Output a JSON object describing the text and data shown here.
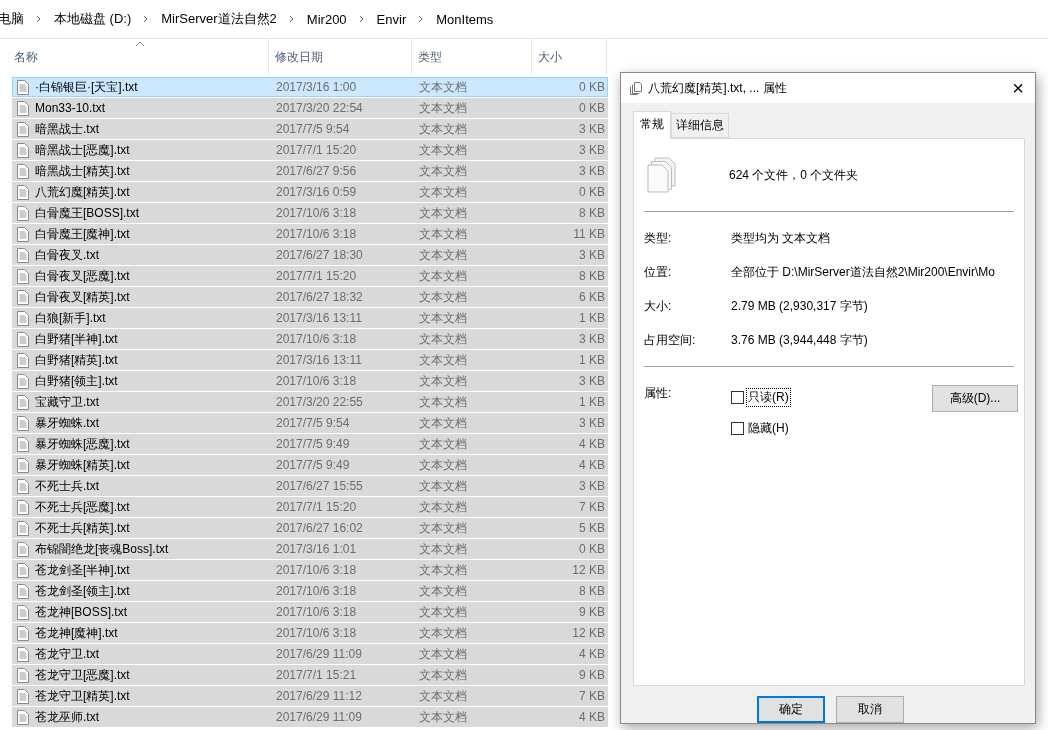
{
  "breadcrumb": [
    "电脑",
    "本地磁盘 (D:)",
    "MirServer道法自然2",
    "Mir200",
    "Envir",
    "MonItems"
  ],
  "columns": [
    {
      "label": "名称",
      "sorted": true
    },
    {
      "label": "修改日期",
      "sorted": false
    },
    {
      "label": "类型",
      "sorted": false
    },
    {
      "label": "大小",
      "sorted": false
    }
  ],
  "files": [
    {
      "name": "·白锦银巨·[天宝].txt",
      "date": "2017/3/16 1:00",
      "type": "文本文档",
      "size": "0 KB",
      "selected": true,
      "focused": true
    },
    {
      "name": "Mon33-10.txt",
      "date": "2017/3/20 22:54",
      "type": "文本文档",
      "size": "0 KB",
      "selected": true,
      "focused": false
    },
    {
      "name": "暗黑战士.txt",
      "date": "2017/7/5 9:54",
      "type": "文本文档",
      "size": "3 KB",
      "selected": true,
      "focused": false
    },
    {
      "name": "暗黑战士[恶魔].txt",
      "date": "2017/7/1 15:20",
      "type": "文本文档",
      "size": "3 KB",
      "selected": true,
      "focused": false
    },
    {
      "name": "暗黑战士[精英].txt",
      "date": "2017/6/27 9:56",
      "type": "文本文档",
      "size": "3 KB",
      "selected": true,
      "focused": false
    },
    {
      "name": "八荒幻魔[精英].txt",
      "date": "2017/3/16 0:59",
      "type": "文本文档",
      "size": "0 KB",
      "selected": true,
      "focused": false
    },
    {
      "name": "白骨魔王[BOSS].txt",
      "date": "2017/10/6 3:18",
      "type": "文本文档",
      "size": "8 KB",
      "selected": true,
      "focused": false
    },
    {
      "name": "白骨魔王[魔神].txt",
      "date": "2017/10/6 3:18",
      "type": "文本文档",
      "size": "11 KB",
      "selected": true,
      "focused": false
    },
    {
      "name": "白骨夜叉.txt",
      "date": "2017/6/27 18:30",
      "type": "文本文档",
      "size": "3 KB",
      "selected": true,
      "focused": false
    },
    {
      "name": "白骨夜叉[恶魔].txt",
      "date": "2017/7/1 15:20",
      "type": "文本文档",
      "size": "8 KB",
      "selected": true,
      "focused": false
    },
    {
      "name": "白骨夜叉[精英].txt",
      "date": "2017/6/27 18:32",
      "type": "文本文档",
      "size": "6 KB",
      "selected": true,
      "focused": false
    },
    {
      "name": "白狼[新手].txt",
      "date": "2017/3/16 13:11",
      "type": "文本文档",
      "size": "1 KB",
      "selected": true,
      "focused": false
    },
    {
      "name": "白野猪[半神].txt",
      "date": "2017/10/6 3:18",
      "type": "文本文档",
      "size": "3 KB",
      "selected": true,
      "focused": false
    },
    {
      "name": "白野猪[精英].txt",
      "date": "2017/3/16 13:11",
      "type": "文本文档",
      "size": "1 KB",
      "selected": true,
      "focused": false
    },
    {
      "name": "白野猪[领主].txt",
      "date": "2017/10/6 3:18",
      "type": "文本文档",
      "size": "3 KB",
      "selected": true,
      "focused": false
    },
    {
      "name": "宝藏守卫.txt",
      "date": "2017/3/20 22:55",
      "type": "文本文档",
      "size": "1 KB",
      "selected": true,
      "focused": false
    },
    {
      "name": "暴牙蜘蛛.txt",
      "date": "2017/7/5 9:54",
      "type": "文本文档",
      "size": "3 KB",
      "selected": true,
      "focused": false
    },
    {
      "name": "暴牙蜘蛛[恶魔].txt",
      "date": "2017/7/5 9:49",
      "type": "文本文档",
      "size": "4 KB",
      "selected": true,
      "focused": false
    },
    {
      "name": "暴牙蜘蛛[精英].txt",
      "date": "2017/7/5 9:49",
      "type": "文本文档",
      "size": "4 KB",
      "selected": true,
      "focused": false
    },
    {
      "name": "不死士兵.txt",
      "date": "2017/6/27 15:55",
      "type": "文本文档",
      "size": "3 KB",
      "selected": true,
      "focused": false
    },
    {
      "name": "不死士兵[恶魔].txt",
      "date": "2017/7/1 15:20",
      "type": "文本文档",
      "size": "7 KB",
      "selected": true,
      "focused": false
    },
    {
      "name": "不死士兵[精英].txt",
      "date": "2017/6/27 16:02",
      "type": "文本文档",
      "size": "5 KB",
      "selected": true,
      "focused": false
    },
    {
      "name": "布锦闇绝龙[丧魂Boss].txt",
      "date": "2017/3/16 1:01",
      "type": "文本文档",
      "size": "0 KB",
      "selected": true,
      "focused": false
    },
    {
      "name": "苍龙剑圣[半神].txt",
      "date": "2017/10/6 3:18",
      "type": "文本文档",
      "size": "12 KB",
      "selected": true,
      "focused": false
    },
    {
      "name": "苍龙剑圣[领主].txt",
      "date": "2017/10/6 3:18",
      "type": "文本文档",
      "size": "8 KB",
      "selected": true,
      "focused": false
    },
    {
      "name": "苍龙神[BOSS].txt",
      "date": "2017/10/6 3:18",
      "type": "文本文档",
      "size": "9 KB",
      "selected": true,
      "focused": false
    },
    {
      "name": "苍龙神[魔神].txt",
      "date": "2017/10/6 3:18",
      "type": "文本文档",
      "size": "12 KB",
      "selected": true,
      "focused": false
    },
    {
      "name": "苍龙守卫.txt",
      "date": "2017/6/29 11:09",
      "type": "文本文档",
      "size": "4 KB",
      "selected": true,
      "focused": false
    },
    {
      "name": "苍龙守卫[恶魔].txt",
      "date": "2017/7/1 15:21",
      "type": "文本文档",
      "size": "9 KB",
      "selected": true,
      "focused": false
    },
    {
      "name": "苍龙守卫[精英].txt",
      "date": "2017/6/29 11:12",
      "type": "文本文档",
      "size": "7 KB",
      "selected": true,
      "focused": false
    },
    {
      "name": "苍龙巫师.txt",
      "date": "2017/6/29 11:09",
      "type": "文本文档",
      "size": "4 KB",
      "selected": true,
      "focused": false
    }
  ],
  "dialog": {
    "title": "八荒幻魔[精英].txt, ... 属性",
    "close": "×",
    "tabs": [
      {
        "label": "常规",
        "selected": true
      },
      {
        "label": "详细信息",
        "selected": false
      }
    ],
    "summary": "624 个文件，0 个文件夹",
    "properties": [
      {
        "label": "类型:",
        "value": "类型均为 文本文档"
      },
      {
        "label": "位置:",
        "value": "全部位于 D:\\MirServer道法自然2\\Mir200\\Envir\\Mo"
      },
      {
        "label": "大小:",
        "value": "2.79 MB (2,930,317 字节)"
      },
      {
        "label": "占用空间:",
        "value": "3.76 MB (3,944,448 字节)"
      }
    ],
    "attributes_label": "属性:",
    "attributes": [
      {
        "label": "只读(R)",
        "checked": false,
        "focused": true
      },
      {
        "label": "隐藏(H)",
        "checked": false,
        "focused": false
      }
    ],
    "advanced_button": "高级(D)...",
    "buttons": [
      {
        "label": "确定",
        "default": true
      },
      {
        "label": "取消",
        "default": false
      }
    ]
  }
}
